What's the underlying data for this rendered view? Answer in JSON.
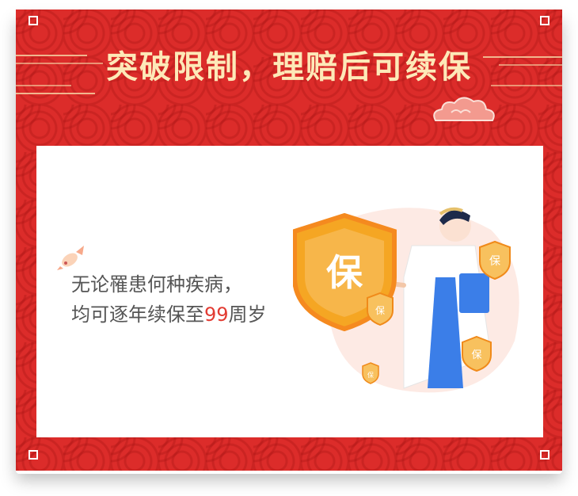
{
  "heading": "突破限制，理赔后可续保",
  "body": {
    "line1": "无论罹患何种疾病，",
    "line2_prefix": "均可逐年续保至",
    "line2_highlight": "99",
    "line2_suffix": "周岁"
  },
  "shield": {
    "main_glyph": "保",
    "badge_glyph": "保"
  },
  "colors": {
    "background_red": "#dc2c2a",
    "title_gold": "#fde9b8",
    "highlight_red": "#e23b32",
    "shield_orange": "#f5a623",
    "doctor_blue": "#3b7ee8"
  }
}
